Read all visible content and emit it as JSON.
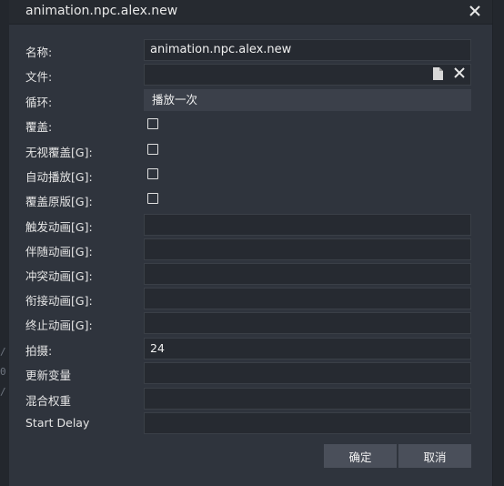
{
  "window": {
    "title": "animation.npc.alex.new"
  },
  "background": {
    "glyphs": [
      "/",
      "0",
      "/"
    ]
  },
  "form": {
    "name": {
      "label": "名称:",
      "value": "animation.npc.alex.new"
    },
    "file": {
      "label": "文件:",
      "value": ""
    },
    "loop": {
      "label": "循环:",
      "value": "播放一次"
    },
    "override": {
      "label": "覆盖:"
    },
    "ignore_override": {
      "label": "无视覆盖[G]:"
    },
    "autoplay": {
      "label": "自动播放[G]:"
    },
    "override_original": {
      "label": "覆盖原版[G]:"
    },
    "trigger_anim": {
      "label": "触发动画[G]:",
      "value": ""
    },
    "follow_anim": {
      "label": "伴随动画[G]:",
      "value": ""
    },
    "conflict_anim": {
      "label": "冲突动画[G]:",
      "value": ""
    },
    "connect_anim": {
      "label": "衔接动画[G]:",
      "value": ""
    },
    "stop_anim": {
      "label": "终止动画[G]:",
      "value": ""
    },
    "beat": {
      "label": "拍摄:",
      "value": "24"
    },
    "update_vars": {
      "label": "更新变量",
      "value": ""
    },
    "blend_weight": {
      "label": "混合权重",
      "value": ""
    },
    "start_delay": {
      "label": "Start Delay",
      "value": ""
    }
  },
  "buttons": {
    "ok": "确定",
    "cancel": "取消"
  },
  "icons": {
    "close": "close-icon",
    "file_browse": "file-icon",
    "file_clear": "clear-icon"
  }
}
